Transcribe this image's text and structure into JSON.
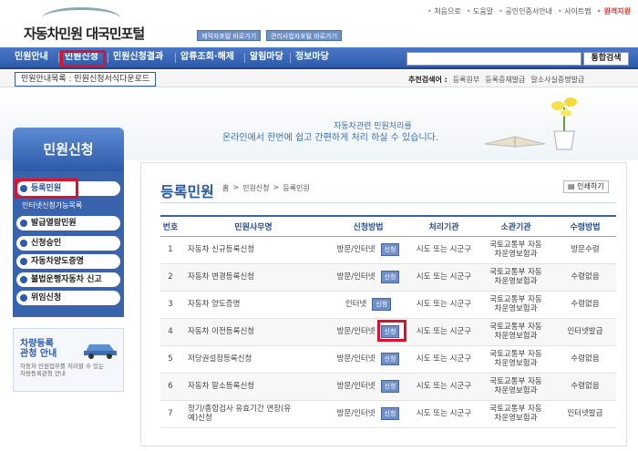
{
  "header": {
    "logo": "자동차민원 대국민포털",
    "portal_links": [
      "제작자포털 바로가기",
      "관리사업자포털 바로가기"
    ],
    "top_links": [
      "처음으로",
      "도움말",
      "공인인증서안내",
      "사이트맵"
    ],
    "top_link_highlight": "원격지원"
  },
  "nav": {
    "items": [
      "민원안내",
      "민원신청",
      "민원신청결과",
      "압류조회·해제",
      "알림마당",
      "정보마당"
    ],
    "search_placeholder": "",
    "search_button": "통합검색"
  },
  "subnav": {
    "tab": "민원안내목록 : 민원신청서식다운로드",
    "recommend_label": "추천검색어 :",
    "recommend_terms": [
      "등록원부",
      "등록증재발급",
      "말소사실증명발급"
    ]
  },
  "banner": {
    "line1": "자동차관련 민원처리를",
    "line2": "온라인에서 한번에 쉽고 간편하게 처리 하실 수 있습니다."
  },
  "sidebar": {
    "title": "민원신청",
    "items": [
      "등록민원",
      "발급열람민원",
      "신청승인",
      "자동차양도증명",
      "불법운행자동차 신고",
      "위임신청"
    ],
    "sub_item": "인터넷신청가능목록",
    "box_title": "차량등록\n관청 안내",
    "box_text": "자동차 민원업무를 처리할 수 있는\n차량등록관청 안내"
  },
  "main": {
    "title": "등록민원",
    "breadcrumb": [
      "홈",
      "민원신청",
      "등록민원"
    ],
    "print_button": "인쇄하기",
    "columns": [
      "번호",
      "민원사무명",
      "신청방법",
      "처리기관",
      "소관기관",
      "수령방법"
    ],
    "apply_label": "신청",
    "rows": [
      {
        "no": "1",
        "name": "자동차 신규등록신청",
        "method": "방문/인터넷",
        "agency": "시도 또는 시군구",
        "owner": "국토교통부 자동\n차운영보험과",
        "receive": "방문수령"
      },
      {
        "no": "2",
        "name": "자동차 변경등록신청",
        "method": "방문/인터넷",
        "agency": "시도 또는 시군구",
        "owner": "국토교통부 자동\n차운영보험과",
        "receive": "수령없음"
      },
      {
        "no": "3",
        "name": "자동차 양도증명",
        "method": "인터넷",
        "agency": "시도 또는 시군구",
        "owner": "국토교통부 자동\n차운영보험과",
        "receive": "수령없음"
      },
      {
        "no": "4",
        "name": "자동차 이전등록신청",
        "method": "방문/인터넷",
        "agency": "시도 또는 시군구",
        "owner": "국토교통부 자동\n차운영보험과",
        "receive": "인터넷발급"
      },
      {
        "no": "5",
        "name": "저당권설정등록신청",
        "method": "방문/인터넷",
        "agency": "시도 또는 시군구",
        "owner": "국토교통부 자동\n차운영보험과",
        "receive": "수령없음"
      },
      {
        "no": "6",
        "name": "자동차 말소등록신청",
        "method": "방문/인터넷",
        "agency": "시도 또는 시군구",
        "owner": "국토교통부 자동\n차운영보험과",
        "receive": "수령없음"
      },
      {
        "no": "7",
        "name": "정기/종합검사 유효기간 연장(유\n예)신청",
        "method": "방문/인터넷",
        "agency": "시도 또는 시군구",
        "owner": "국토교통부 자동\n차운영보험과",
        "receive": "인터넷발급"
      }
    ]
  }
}
